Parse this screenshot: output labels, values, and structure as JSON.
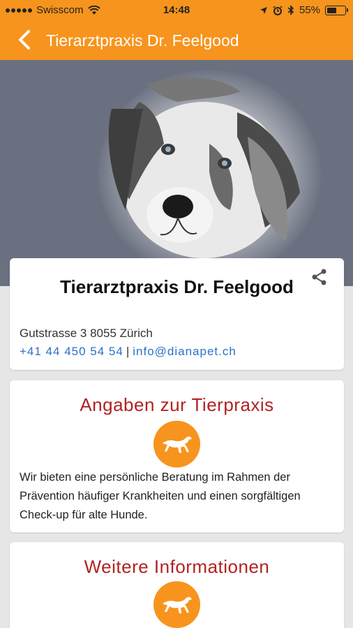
{
  "status_bar": {
    "carrier": "Swisscom",
    "time": "14:48",
    "battery": "55%",
    "battery_level": 0.55
  },
  "nav": {
    "title": "Tierarztpraxis Dr. Feelgood"
  },
  "info": {
    "title": "Tierarztpraxis Dr. Feelgood",
    "address": "Gutstrasse 3 8055 Zürich",
    "phone": "+41 44 450 54 54",
    "separator": "|",
    "email": "info@dianapet.ch"
  },
  "about": {
    "title": "Angaben zur Tierpraxis",
    "text": "Wir bieten eine persönliche Beratung im Rahmen der Prävention häufiger Krankheiten und einen sorgfältigen Check-up für alte Hunde."
  },
  "more": {
    "title": "Weitere Informationen"
  },
  "colors": {
    "accent": "#f7941d",
    "heading": "#b22222",
    "link": "#2a72c8",
    "hero_bg": "#6a7080"
  },
  "icons": [
    "back-chevron-icon",
    "share-icon",
    "greyhound-icon",
    "wifi-icon",
    "location-arrow-icon",
    "alarm-icon",
    "bluetooth-icon",
    "battery-icon",
    "dog-photo"
  ]
}
